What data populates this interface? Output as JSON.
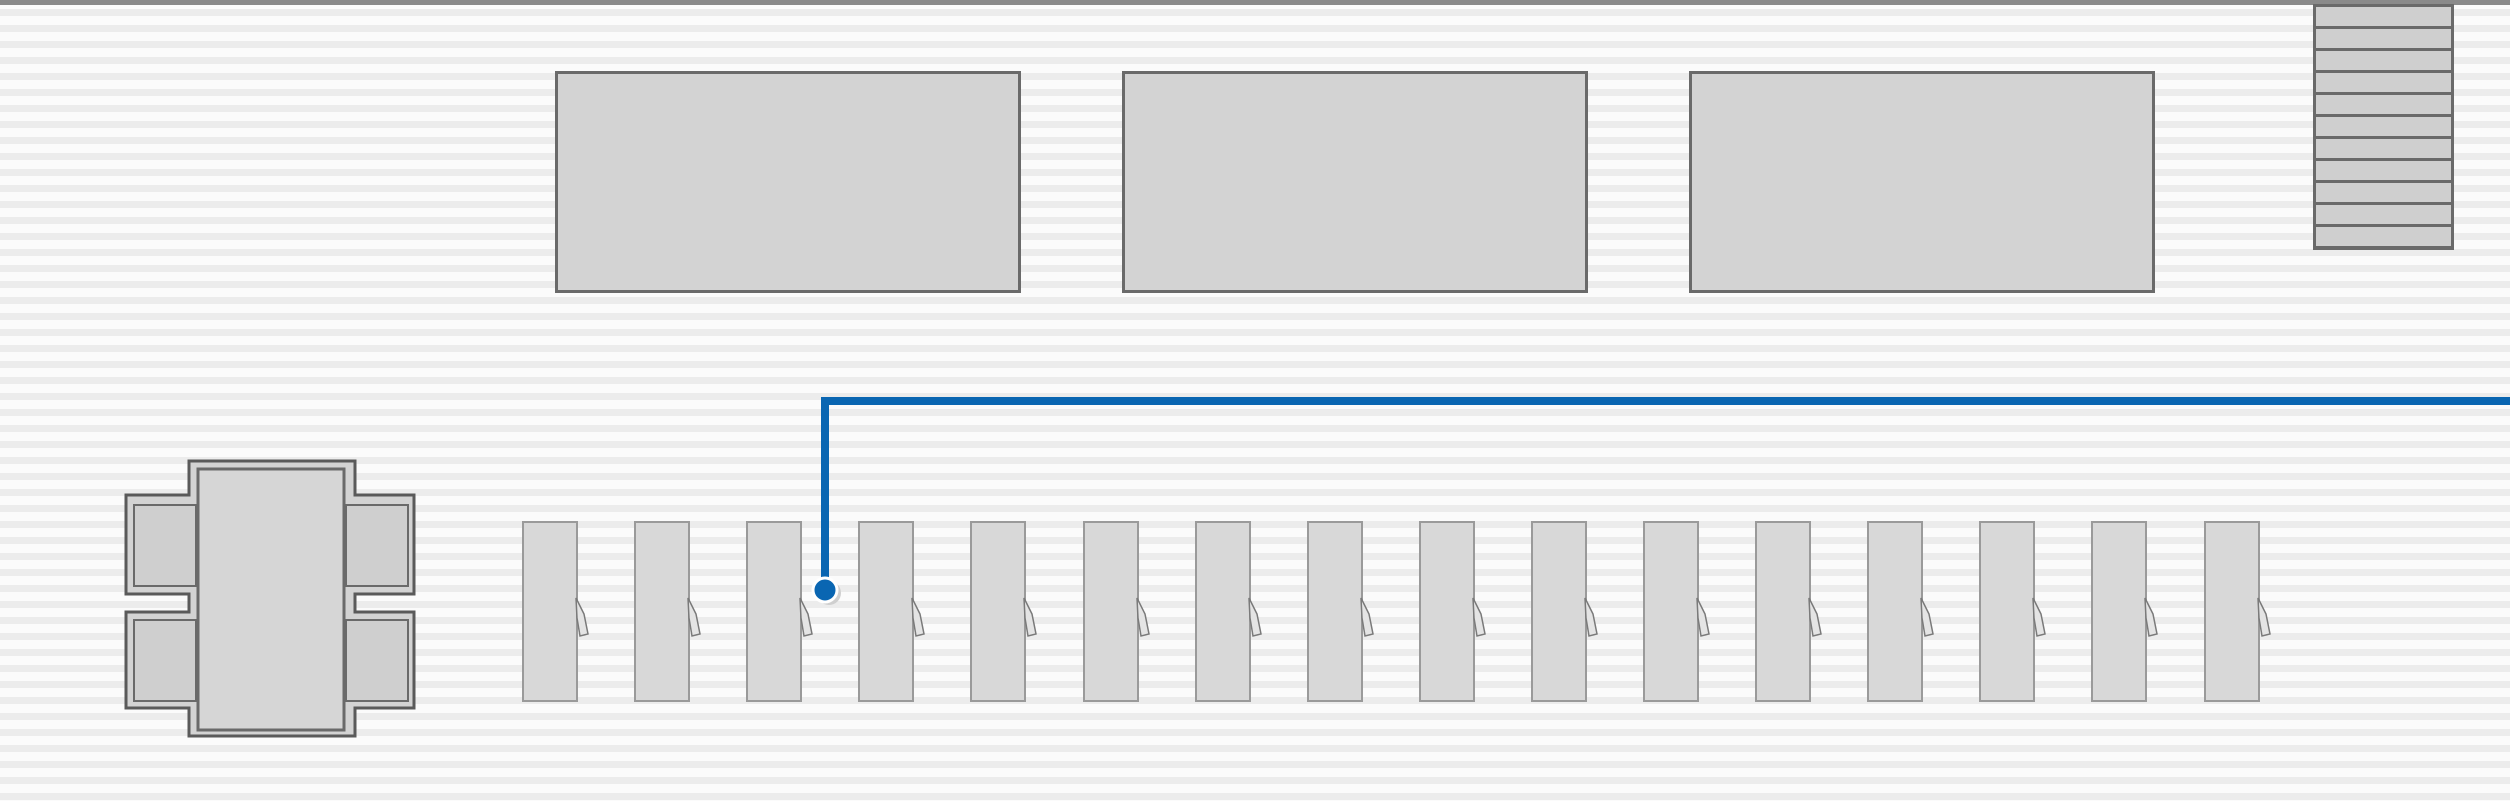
{
  "plan": {
    "background_style": "striped-floor",
    "accent_color": "#0a66b2",
    "outline_color": "#6a6a6a",
    "fill_color": "#d3d3d3"
  },
  "elements": {
    "large_tables": 3,
    "workstations": 16,
    "conference_table_chairs": 4,
    "staircase_treads": 11
  },
  "route": {
    "type": "path-line",
    "color": "#0a66b2",
    "ends_at": "right-edge",
    "marker": "location-pin"
  }
}
